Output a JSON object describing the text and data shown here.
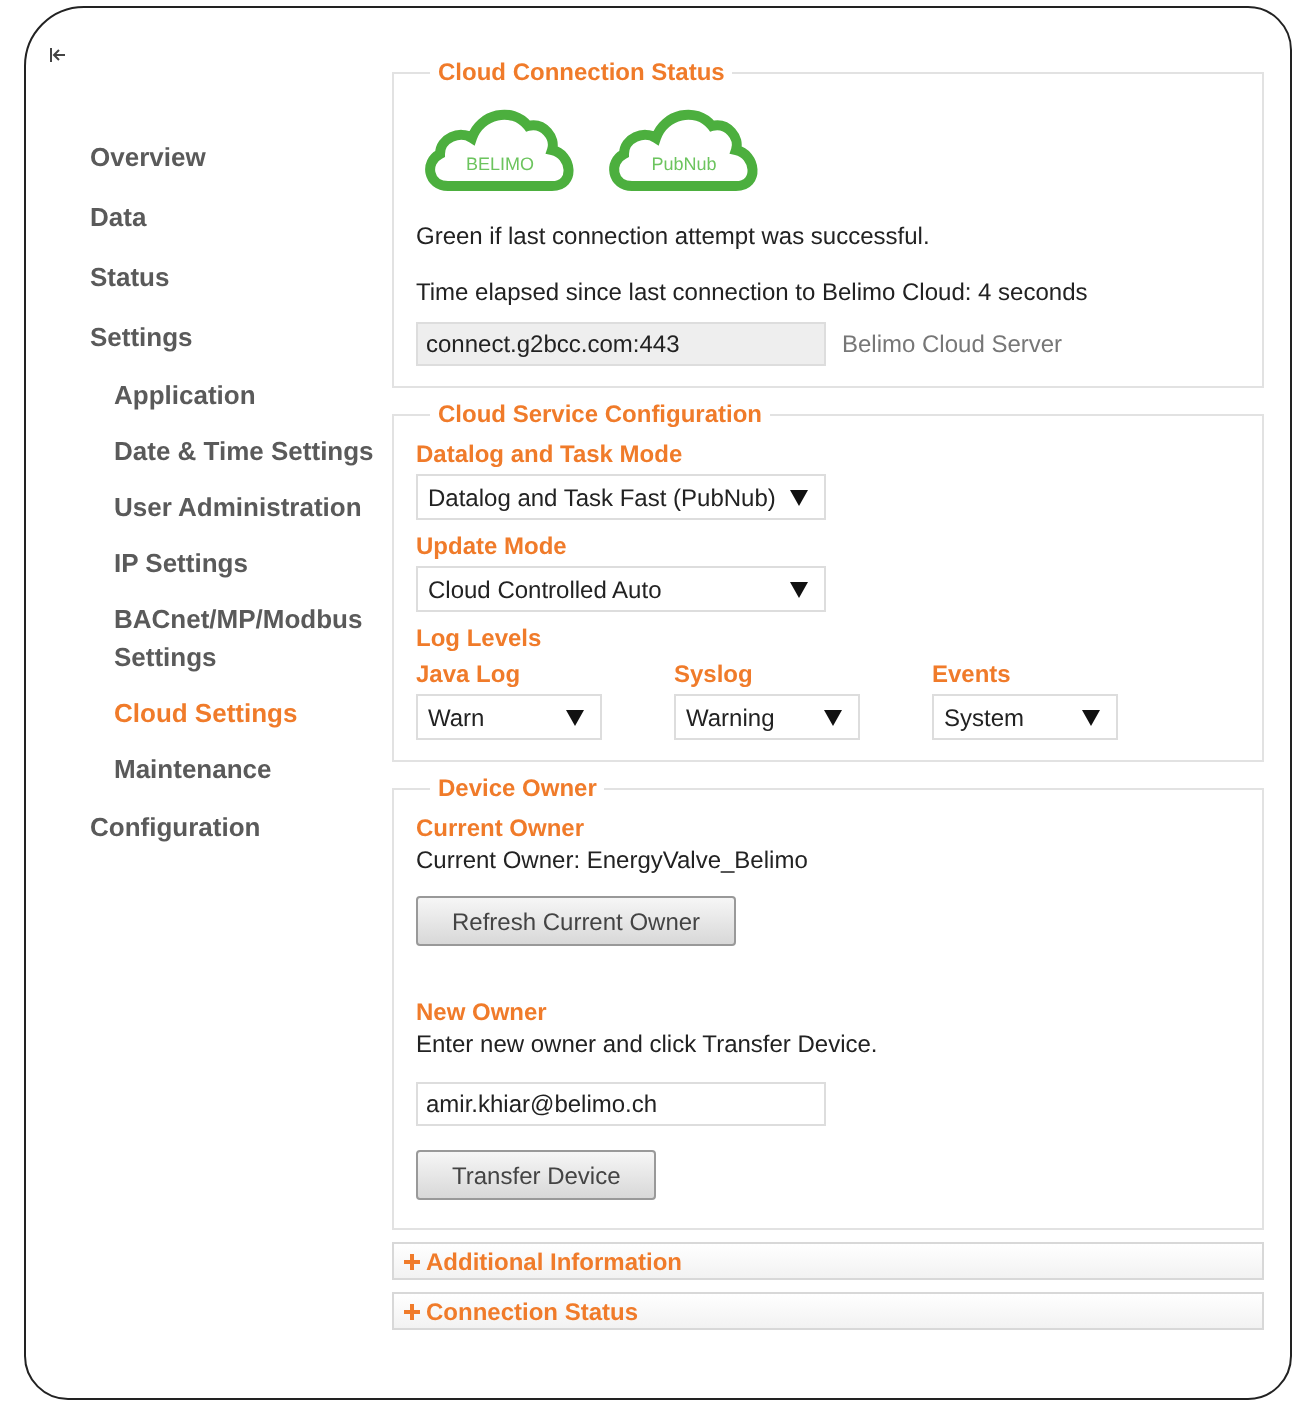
{
  "sidebar": {
    "items": [
      {
        "label": "Overview",
        "selected": false
      },
      {
        "label": "Data",
        "selected": false
      },
      {
        "label": "Status",
        "selected": false
      },
      {
        "label": "Settings",
        "selected": false,
        "children": [
          {
            "label": "Application",
            "selected": false
          },
          {
            "label": "Date & Time Settings",
            "selected": false
          },
          {
            "label": "User Administration",
            "selected": false
          },
          {
            "label": "IP Settings",
            "selected": false
          },
          {
            "label": "BACnet/MP/Modbus Settings",
            "selected": false
          },
          {
            "label": "Cloud Settings",
            "selected": true
          },
          {
            "label": "Maintenance",
            "selected": false
          }
        ]
      },
      {
        "label": "Configuration",
        "selected": false
      }
    ]
  },
  "cloud_status": {
    "title": "Cloud Connection Status",
    "clouds": [
      {
        "label": "BELIMO",
        "connected": true
      },
      {
        "label": "PubNub",
        "connected": true
      }
    ],
    "note": "Green if last connection attempt was successful.",
    "elapsed": "Time elapsed since last connection to Belimo Cloud: 4 seconds",
    "server": {
      "value": "connect.g2bcc.com:443",
      "label": "Belimo Cloud Server"
    }
  },
  "service_config": {
    "title": "Cloud Service Configuration",
    "datalog_mode": {
      "label": "Datalog and Task Mode",
      "value": "Datalog and Task Fast (PubNub)"
    },
    "update_mode": {
      "label": "Update Mode",
      "value": "Cloud Controlled Auto"
    },
    "log_levels": {
      "label": "Log Levels",
      "items": [
        {
          "label": "Java Log",
          "value": "Warn"
        },
        {
          "label": "Syslog",
          "value": "Warning"
        },
        {
          "label": "Events",
          "value": "System"
        }
      ]
    }
  },
  "device_owner": {
    "title": "Device Owner",
    "current": {
      "heading": "Current Owner",
      "text": "Current Owner: EnergyValve_Belimo",
      "button": "Refresh Current Owner"
    },
    "new": {
      "heading": "New Owner",
      "text": "Enter new owner and click Transfer Device.",
      "value": "amir.khiar@belimo.ch",
      "button": "Transfer Device"
    }
  },
  "accordions": [
    {
      "label": "Additional Information",
      "expanded": false
    },
    {
      "label": "Connection Status",
      "expanded": false
    }
  ]
}
